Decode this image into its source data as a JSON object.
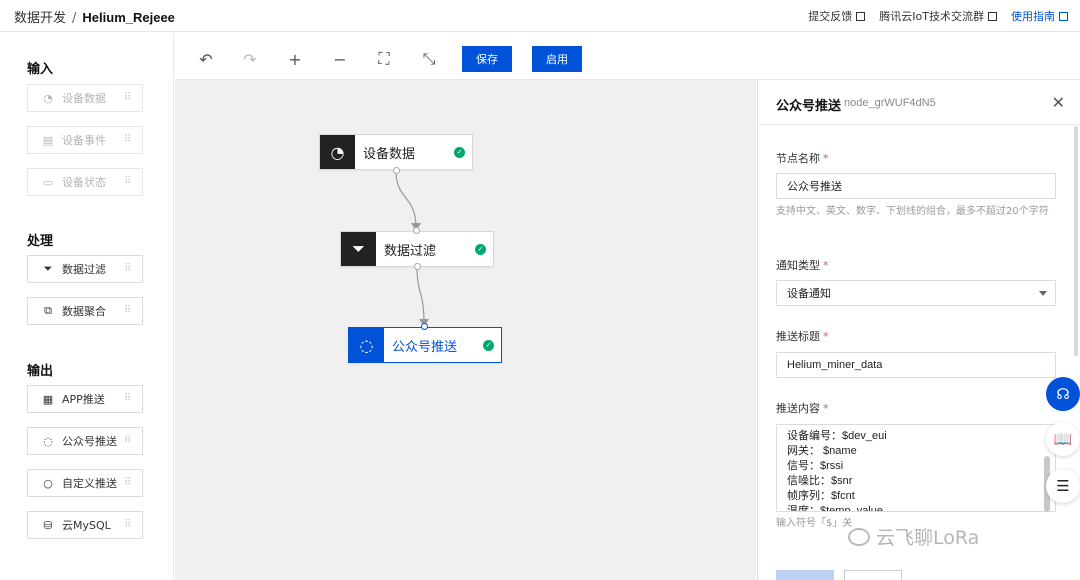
{
  "header": {
    "breadcrumb_root": "数据开发",
    "separator": "/",
    "project": "Helium_Rejeee",
    "links": [
      {
        "label": "提交反馈"
      },
      {
        "label": "腾讯云IoT技术交流群"
      },
      {
        "label": "使用指南"
      }
    ]
  },
  "sidebar": {
    "groups": [
      {
        "title": "输入",
        "items": [
          {
            "label": "设备数据",
            "icon": "pie-chart-icon"
          },
          {
            "label": "设备事件",
            "icon": "document-icon"
          },
          {
            "label": "设备状态",
            "icon": "image-icon"
          }
        ]
      },
      {
        "title": "处理",
        "items": [
          {
            "label": "数据过滤",
            "icon": "filter-icon"
          },
          {
            "label": "数据聚合",
            "icon": "copy-icon"
          }
        ]
      },
      {
        "title": "输出",
        "items": [
          {
            "label": "APP推送",
            "icon": "grid-icon"
          },
          {
            "label": "公众号推送",
            "icon": "chat-icon"
          },
          {
            "label": "自定义推送",
            "icon": "bulb-icon"
          },
          {
            "label": "云MySQL",
            "icon": "database-icon"
          }
        ]
      }
    ]
  },
  "toolbar": {
    "save_label": "保存",
    "enable_label": "启用"
  },
  "flow": {
    "nodes": [
      {
        "label": "设备数据",
        "icon": "pie-chart-icon"
      },
      {
        "label": "数据过滤",
        "icon": "filter-icon"
      },
      {
        "label": "公众号推送",
        "icon": "chat-icon"
      }
    ]
  },
  "panel": {
    "title": "公众号推送",
    "node_id": "node_grWUF4dN5",
    "fields": {
      "name_label": "节点名称",
      "name_value": "公众号推送",
      "name_help": "支持中文、英文、数字、下划线的组合，最多不超过20个字符",
      "type_label": "通知类型",
      "type_value": "设备通知",
      "title_label": "推送标题",
      "title_value": "Helium_miner_data",
      "content_label": "推送内容",
      "content_lines": [
        "设备编号：$dev_eui",
        "网关： $name",
        "信号：$rssi",
        "信噪比：$snr",
        "帧序列：$fcnt",
        "温度：$temp_value"
      ],
      "content_help": "输入符号「$」关"
    }
  },
  "watermark": "云飞聊LoRa",
  "colors": {
    "primary": "#0052d9",
    "success": "#00a870",
    "dark": "#222222",
    "required": "#e34d59"
  }
}
